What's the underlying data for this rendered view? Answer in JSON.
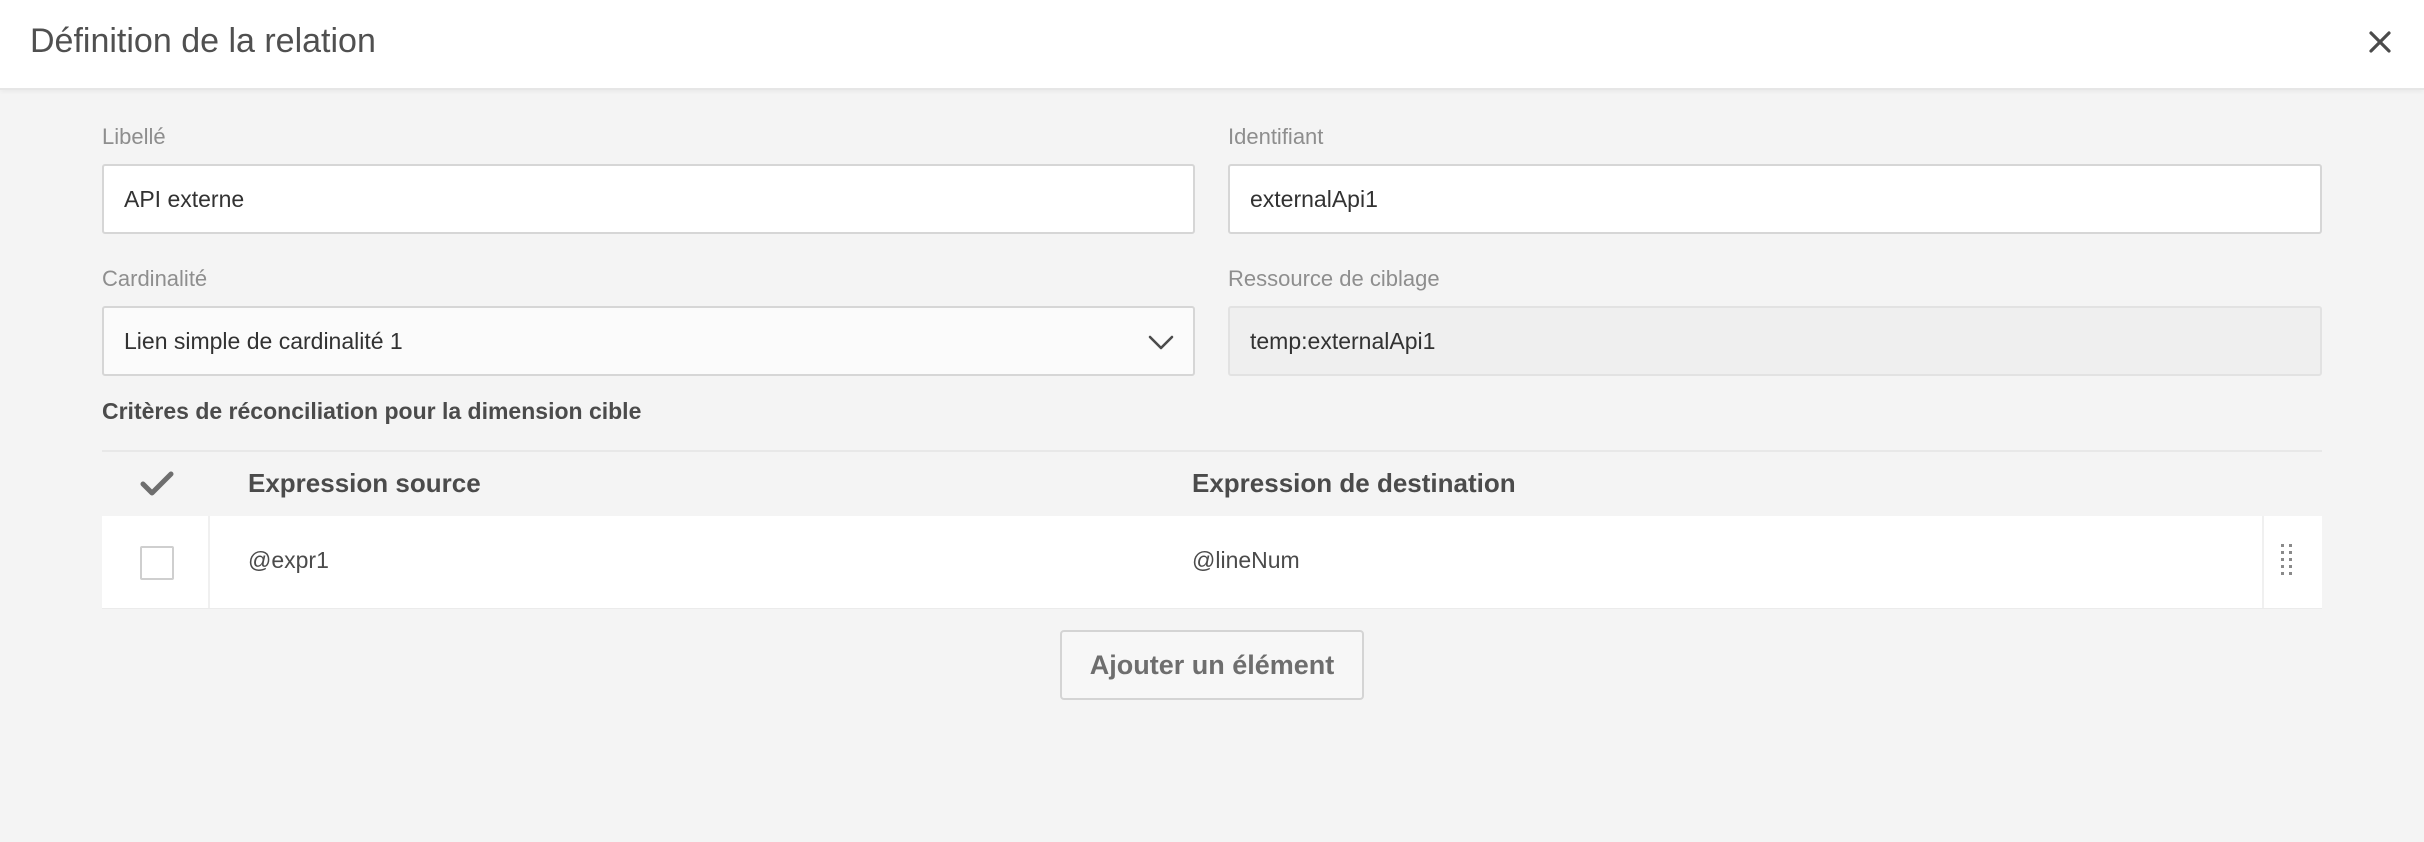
{
  "dialog": {
    "title": "Définition de la relation",
    "close_icon": "close-icon"
  },
  "form": {
    "label": {
      "label": "Libellé",
      "value": "API externe"
    },
    "identifier": {
      "label": "Identifiant",
      "value": "externalApi1"
    },
    "cardinality": {
      "label": "Cardinalité",
      "value": "Lien simple de cardinalité 1",
      "icon": "chevron-down-icon"
    },
    "targeting_resource": {
      "label": "Ressource de ciblage",
      "value": "temp:externalApi1"
    }
  },
  "reconciliation": {
    "title": "Critères de réconciliation pour la dimension cible",
    "columns": {
      "select_icon": "checkmark-icon",
      "source": "Expression source",
      "destination": "Expression de destination"
    },
    "rows": [
      {
        "checked": false,
        "source": "@expr1",
        "destination": "@lineNum",
        "handle_icon": "drag-handle-icon"
      }
    ],
    "add_button": "Ajouter un élément"
  },
  "colors": {
    "background": "#f4f4f4",
    "header_background": "#ffffff",
    "label_text": "#8e8e8e",
    "field_border": "#d6d6d6",
    "readonly_background": "#efefef"
  }
}
